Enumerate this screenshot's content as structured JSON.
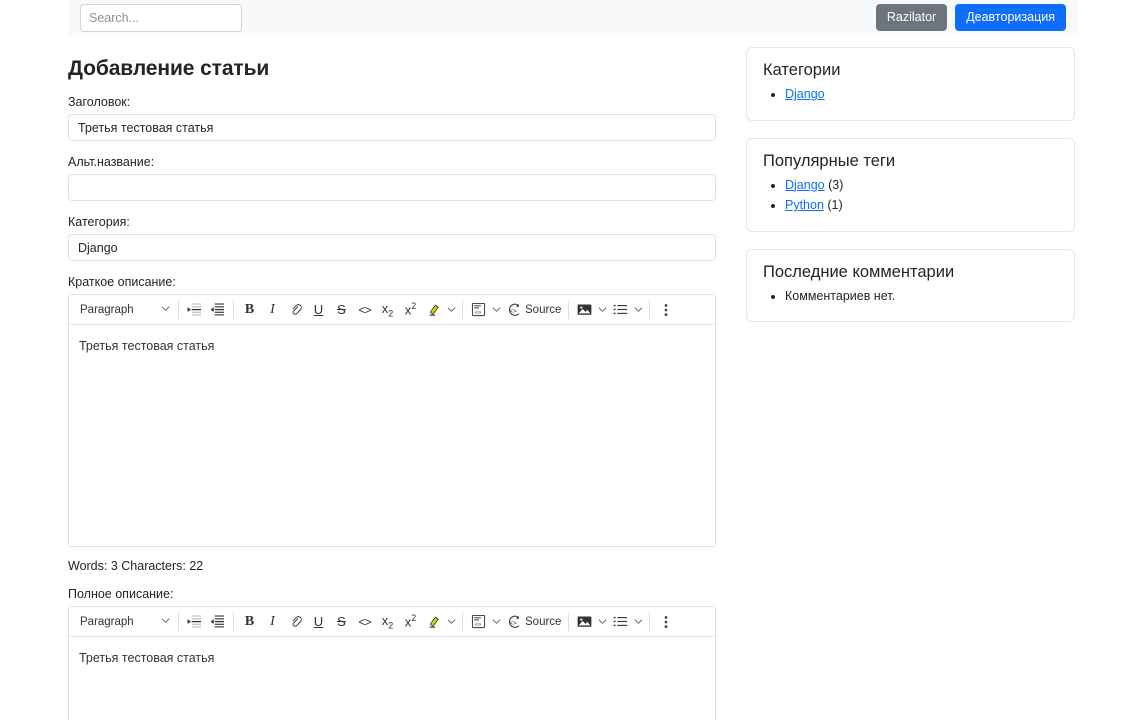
{
  "header": {
    "search_placeholder": "Search...",
    "search_value": "",
    "buttons": {
      "user_label": "Razilator",
      "logout_label": "Деавторизация"
    },
    "colors": {
      "secondary": "#6c757d",
      "primary": "#0d6efd",
      "bar_bg": "#f8f9fa"
    }
  },
  "main": {
    "title": "Добавление статьи",
    "fields": {
      "title_label": "Заголовок:",
      "title_value": "Третья тестовая статья",
      "alt_label": "Альт.название:",
      "alt_value": "",
      "category_label": "Категория:",
      "category_value": "Django",
      "short_desc_label": "Краткое описание:",
      "short_desc_value": "Третья тестовая статья",
      "word_count": "Words: 3  Characters: 22",
      "full_desc_label": "Полное описание:",
      "full_desc_value": "Третья тестовая статья"
    },
    "editor_toolbar": {
      "paragraph_label": "Paragraph",
      "source_label": "Source",
      "icons": [
        "outdent-icon",
        "indent-icon",
        "bold-icon",
        "italic-icon",
        "link-icon",
        "underline-icon",
        "strikethrough-icon",
        "code-icon",
        "subscript-icon",
        "superscript-icon",
        "highlight-icon",
        "insert-template-icon",
        "source-editing-icon",
        "image-icon",
        "bulleted-list-icon",
        "more-options-icon"
      ],
      "highlight_color": "#d7d70f"
    }
  },
  "sidebar": {
    "cards": [
      {
        "title": "Категории",
        "items": [
          {
            "link": "Django",
            "suffix": ""
          }
        ]
      },
      {
        "title": "Популярные теги",
        "items": [
          {
            "link": "Django",
            "suffix": " (3)"
          },
          {
            "link": "Python",
            "suffix": " (1)"
          }
        ]
      },
      {
        "title": "Последние комментарии",
        "items": [
          {
            "link": "",
            "suffix": "Комментариев нет."
          }
        ]
      }
    ]
  }
}
